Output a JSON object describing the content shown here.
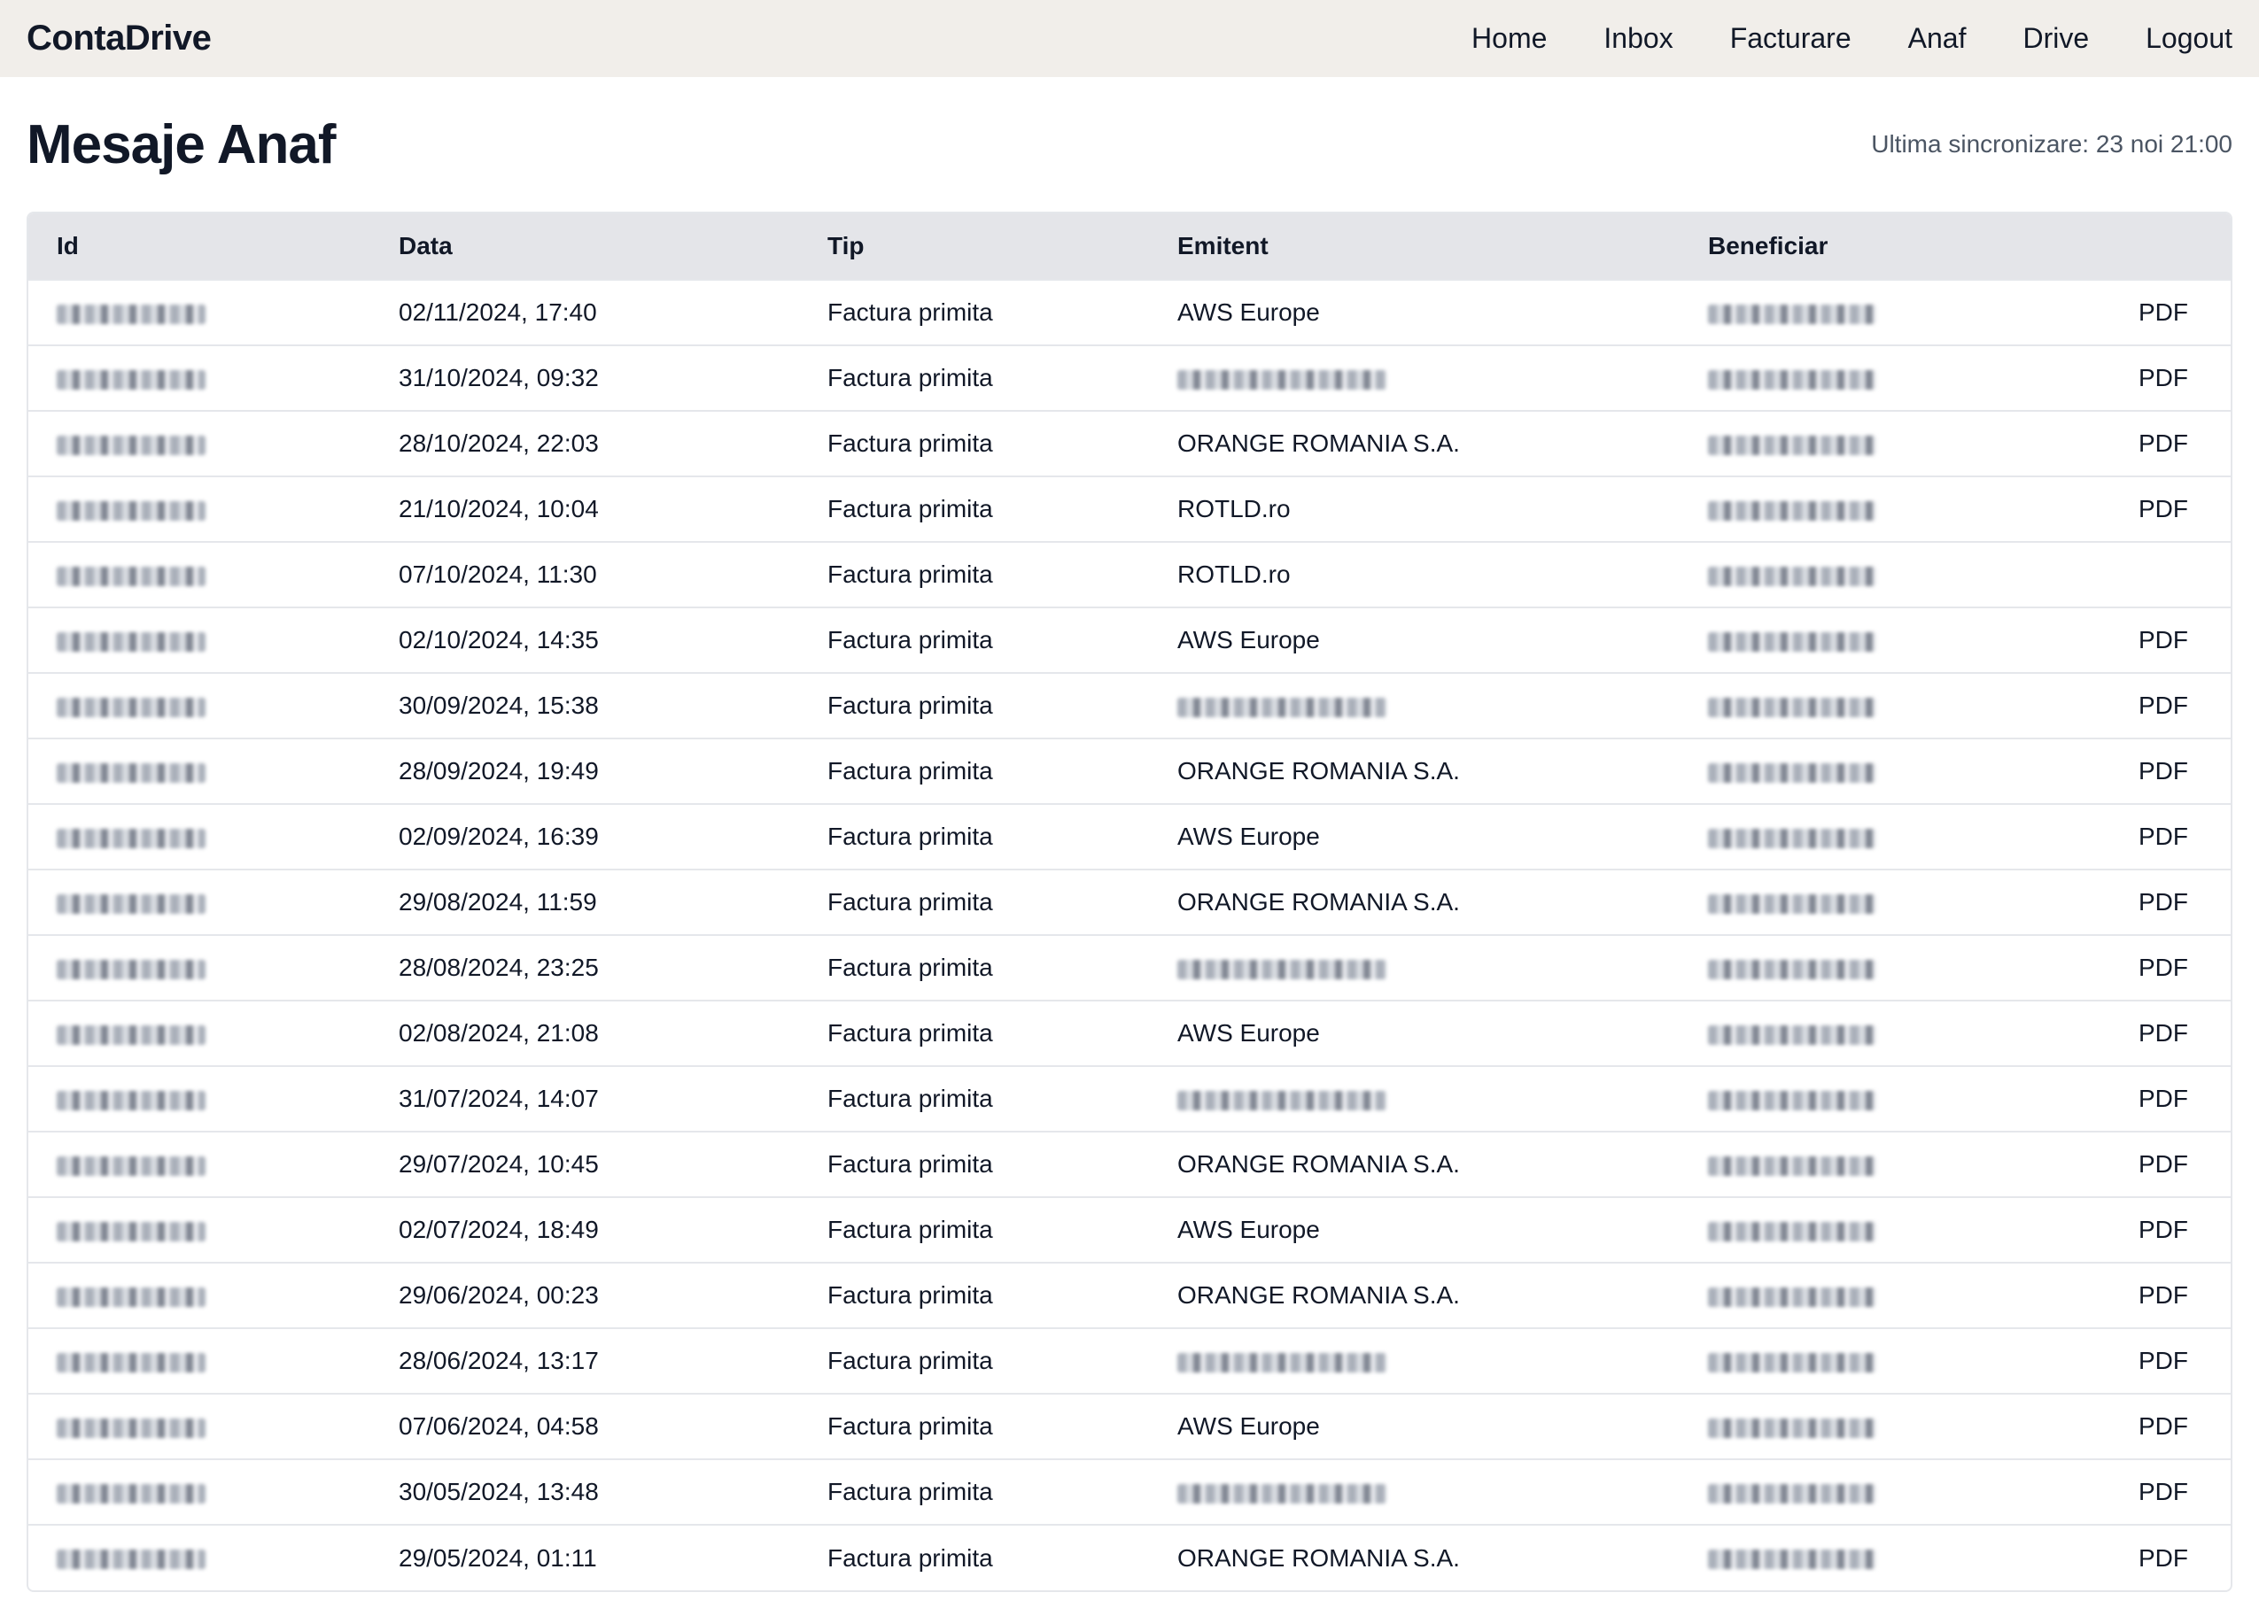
{
  "app": {
    "brand": "ContaDrive",
    "nav": [
      "Home",
      "Inbox",
      "Facturare",
      "Anaf",
      "Drive",
      "Logout"
    ]
  },
  "page": {
    "title": "Mesaje Anaf",
    "sync_text": "Ultima sincronizare: 23 noi 21:00"
  },
  "table": {
    "columns": [
      "Id",
      "Data",
      "Tip",
      "Emitent",
      "Beneficiar",
      ""
    ],
    "rows": [
      {
        "data": "02/11/2024, 17:40",
        "tip": "Factura primita",
        "emitent": "AWS Europe",
        "pdf": "PDF"
      },
      {
        "data": "31/10/2024, 09:32",
        "tip": "Factura primita",
        "emitent": "",
        "pdf": "PDF"
      },
      {
        "data": "28/10/2024, 22:03",
        "tip": "Factura primita",
        "emitent": "ORANGE ROMANIA S.A.",
        "pdf": "PDF"
      },
      {
        "data": "21/10/2024, 10:04",
        "tip": "Factura primita",
        "emitent": "ROTLD.ro",
        "pdf": "PDF"
      },
      {
        "data": "07/10/2024, 11:30",
        "tip": "Factura primita",
        "emitent": "ROTLD.ro",
        "pdf": ""
      },
      {
        "data": "02/10/2024, 14:35",
        "tip": "Factura primita",
        "emitent": "AWS Europe",
        "pdf": "PDF"
      },
      {
        "data": "30/09/2024, 15:38",
        "tip": "Factura primita",
        "emitent": "",
        "pdf": "PDF"
      },
      {
        "data": "28/09/2024, 19:49",
        "tip": "Factura primita",
        "emitent": "ORANGE ROMANIA S.A.",
        "pdf": "PDF"
      },
      {
        "data": "02/09/2024, 16:39",
        "tip": "Factura primita",
        "emitent": "AWS Europe",
        "pdf": "PDF"
      },
      {
        "data": "29/08/2024, 11:59",
        "tip": "Factura primita",
        "emitent": "ORANGE ROMANIA S.A.",
        "pdf": "PDF"
      },
      {
        "data": "28/08/2024, 23:25",
        "tip": "Factura primita",
        "emitent": "",
        "pdf": "PDF"
      },
      {
        "data": "02/08/2024, 21:08",
        "tip": "Factura primita",
        "emitent": "AWS Europe",
        "pdf": "PDF"
      },
      {
        "data": "31/07/2024, 14:07",
        "tip": "Factura primita",
        "emitent": "",
        "pdf": "PDF"
      },
      {
        "data": "29/07/2024, 10:45",
        "tip": "Factura primita",
        "emitent": "ORANGE ROMANIA S.A.",
        "pdf": "PDF"
      },
      {
        "data": "02/07/2024, 18:49",
        "tip": "Factura primita",
        "emitent": "AWS Europe",
        "pdf": "PDF"
      },
      {
        "data": "29/06/2024, 00:23",
        "tip": "Factura primita",
        "emitent": "ORANGE ROMANIA S.A.",
        "pdf": "PDF"
      },
      {
        "data": "28/06/2024, 13:17",
        "tip": "Factura primita",
        "emitent": "",
        "pdf": "PDF"
      },
      {
        "data": "07/06/2024, 04:58",
        "tip": "Factura primita",
        "emitent": "AWS Europe",
        "pdf": "PDF"
      },
      {
        "data": "30/05/2024, 13:48",
        "tip": "Factura primita",
        "emitent": "",
        "pdf": "PDF"
      },
      {
        "data": "29/05/2024, 01:11",
        "tip": "Factura primita",
        "emitent": "ORANGE ROMANIA S.A.",
        "pdf": "PDF"
      }
    ]
  }
}
